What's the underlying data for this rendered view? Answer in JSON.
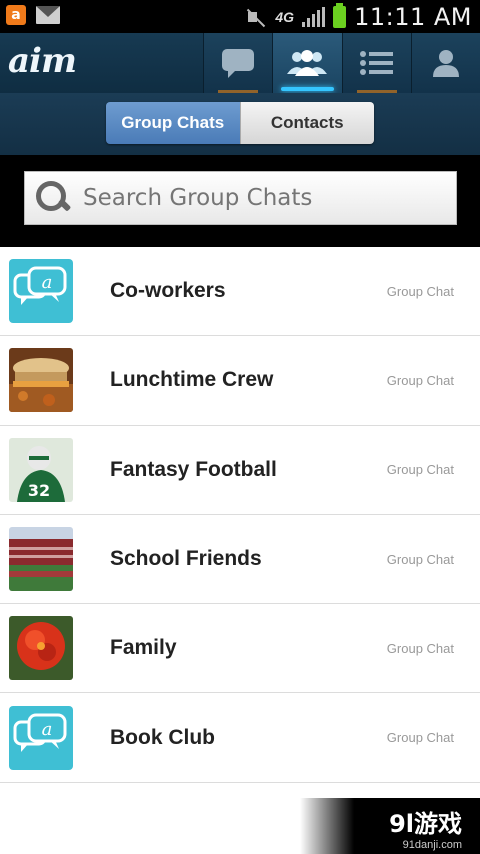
{
  "status_bar": {
    "time": "11:11 AM",
    "network": "4G",
    "icons": [
      "app-notification-icon",
      "gmail-icon",
      "mute-icon",
      "signal-icon",
      "battery-icon"
    ]
  },
  "header": {
    "logo": "aim",
    "nav": [
      {
        "icon": "chat-bubble-icon"
      },
      {
        "icon": "group-icon",
        "active": true
      },
      {
        "icon": "list-icon"
      },
      {
        "icon": "profile-icon"
      }
    ]
  },
  "tabs": [
    {
      "label": "Group Chats",
      "active": true
    },
    {
      "label": "Contacts",
      "active": false
    }
  ],
  "search": {
    "placeholder": "Search Group Chats"
  },
  "groups": [
    {
      "name": "Co-workers",
      "type": "Group Chat",
      "thumb": "aim-chat-icon"
    },
    {
      "name": "Lunchtime Crew",
      "type": "Group Chat",
      "thumb": "sandwich-photo"
    },
    {
      "name": "Fantasy Football",
      "type": "Group Chat",
      "thumb": "football-player-photo"
    },
    {
      "name": "School Friends",
      "type": "Group Chat",
      "thumb": "stadium-photo"
    },
    {
      "name": "Family",
      "type": "Group Chat",
      "thumb": "red-flower-photo"
    },
    {
      "name": "Book Club",
      "type": "Group Chat",
      "thumb": "aim-chat-icon"
    }
  ],
  "watermark": {
    "main": "9l游戏",
    "sub": "91danji.com"
  },
  "colors": {
    "accent": "#35c6ff",
    "header_bg": "#173a52",
    "tab_active": "#4a7bb7",
    "aim_icon": "#3fbfd4"
  }
}
